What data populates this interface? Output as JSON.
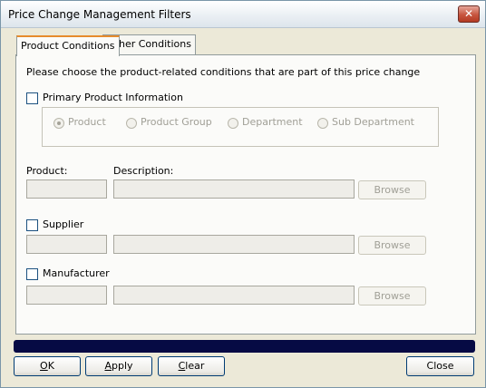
{
  "window": {
    "title": "Price Change Management Filters",
    "close_glyph": "✕"
  },
  "tabs": [
    {
      "label": "Product Conditions",
      "active": true
    },
    {
      "label": "Other Conditions",
      "active": false
    }
  ],
  "panel": {
    "instructions": "Please choose the product-related conditions that are part of this price change",
    "primary": {
      "label": "Primary Product Information",
      "checked": false,
      "options": [
        {
          "label": "Product",
          "selected": true
        },
        {
          "label": "Product Group",
          "selected": false
        },
        {
          "label": "Department",
          "selected": false
        },
        {
          "label": "Sub Department",
          "selected": false
        }
      ]
    },
    "product_label": "Product:",
    "description_label": "Description:",
    "product_browse": "Browse",
    "supplier": {
      "label": "Supplier",
      "checked": false,
      "browse": "Browse"
    },
    "manufacturer": {
      "label": "Manufacturer",
      "checked": false,
      "browse": "Browse"
    }
  },
  "buttons": {
    "ok": {
      "accel": "O",
      "rest": "K"
    },
    "apply": {
      "accel": "A",
      "rest": "pply"
    },
    "clear": {
      "accel": "C",
      "rest": "lear"
    },
    "close": "Close"
  }
}
